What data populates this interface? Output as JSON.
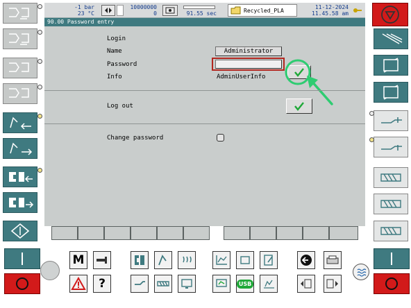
{
  "status": {
    "pressure": "-1 bar",
    "temperature": "23 °C",
    "counter_top": "10000000",
    "counter_bottom": "0",
    "cycle_time": "91.55 sec",
    "file_name": "Recycled_PLA",
    "date": "11-12-2024",
    "time": "11.45.58 am"
  },
  "page": {
    "title": "90.00 Password entry"
  },
  "login": {
    "section_label": "Login",
    "name_label": "Name",
    "name_value": "Administrator",
    "password_label": "Password",
    "password_value": "",
    "info_label": "Info",
    "info_value": "AdminUserInfo",
    "confirm_icon": "check-icon"
  },
  "logout": {
    "label": "Log out",
    "confirm_icon": "check-icon"
  },
  "change_password": {
    "label": "Change password"
  },
  "bottom_keys": {
    "m_label": "M",
    "help_label": "?",
    "usb_label": "USB"
  },
  "colors": {
    "panel": "#c9cdcc",
    "accent_teal": "#3f7a80",
    "highlight_red": "#b3261e",
    "annotation_green": "#2ecc71",
    "check_green": "#1fa838"
  }
}
